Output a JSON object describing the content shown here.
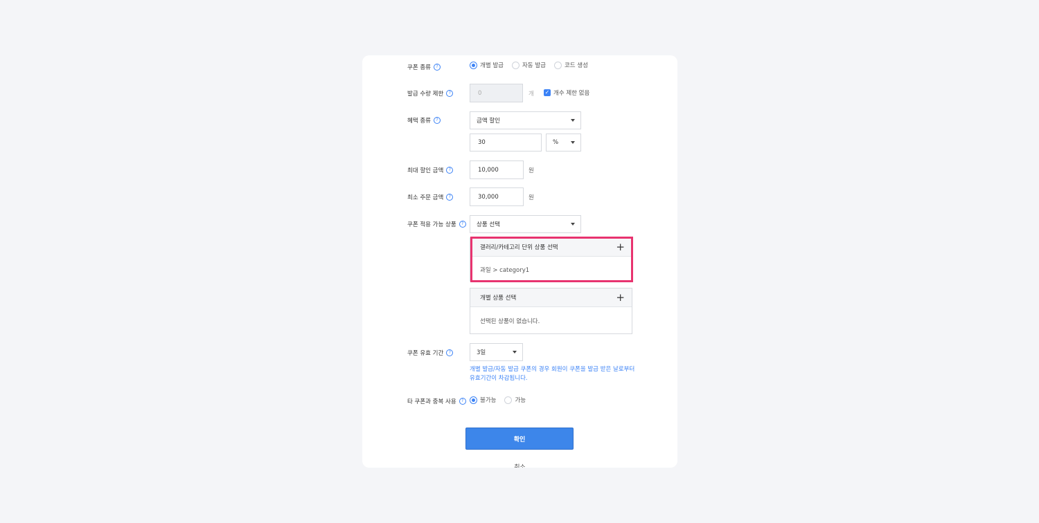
{
  "form": {
    "coupon_type": {
      "label": "쿠폰 종류",
      "options": [
        "개별 발급",
        "자동 발급",
        "코드 생성"
      ],
      "selected": "개별 발급"
    },
    "issue_limit": {
      "label": "발급 수량 제한",
      "value": "0",
      "unit": "개",
      "no_limit_label": "개수 제한 없음",
      "no_limit_checked": true
    },
    "benefit_type": {
      "label": "혜택 종류",
      "selected": "금액 할인",
      "amount": "30",
      "amount_unit": "%"
    },
    "max_discount": {
      "label": "최대 할인 금액",
      "value": "10,000",
      "unit": "원"
    },
    "min_order": {
      "label": "최소 주문 금액",
      "value": "30,000",
      "unit": "원"
    },
    "applicable_products": {
      "label": "쿠폰 적용 가능 상품",
      "selected": "상품 선택",
      "gallery_panel": {
        "title": "갤러리/카테고리 단위 상품 선택",
        "item": "과일 > category1"
      },
      "individual_panel": {
        "title": "개별 상품 선택",
        "empty": "선택된 상품이 없습니다."
      }
    },
    "validity": {
      "label": "쿠폰 유효 기간",
      "selected": "3일",
      "help": "개별 발급/자동 발급 쿠폰의 경우 회원이 쿠폰을 발급 받은 날로부터 유효기간이 차감됩니다."
    },
    "duplicate_use": {
      "label": "타 쿠폰과 중복 사용",
      "options": [
        "불가능",
        "가능"
      ],
      "selected": "불가능"
    }
  },
  "actions": {
    "confirm": "확인",
    "cancel": "취소"
  },
  "colors": {
    "accent": "#3d86ea",
    "highlight": "#e8336f"
  }
}
